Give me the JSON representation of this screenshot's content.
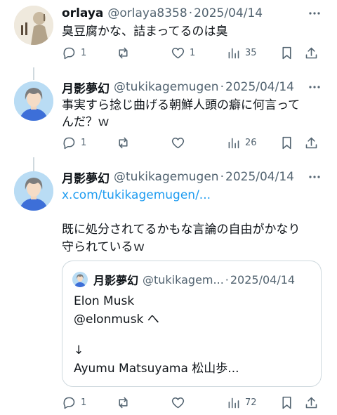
{
  "posts": [
    {
      "name": "orlaya",
      "handle": "@orlaya8358",
      "dot": "·",
      "date": "2025/04/14",
      "text": "臭豆腐かな、詰まってるのは臭",
      "replies": "1",
      "likes": "1",
      "views": "35"
    },
    {
      "name": "月影夢幻",
      "handle": "@tukikagemugen",
      "dot": "·",
      "date": "2025/04/14",
      "text_line1": "事実すら捻じ曲げる朝鮮人頭の癖に何言って",
      "text_line2": "んだ？ｗ",
      "replies": "1",
      "views": "26"
    },
    {
      "name": "月影夢幻",
      "handle": "@tukikagemugen",
      "dot": "·",
      "date": "2025/04/14",
      "link": "x.com/tukikagemugen/...",
      "text_line1": "既に処分されてるかもな言論の自由がかなり",
      "text_line2": "守られているｗ",
      "replies": "1",
      "views": "72",
      "quote": {
        "name": "月影夢幻",
        "handle": "@tukikagem...",
        "dot": "·",
        "date": "2025/04/14",
        "line1": "Elon Musk",
        "line2": "@elonmusk へ",
        "line3": "↓",
        "line4": "Ayumu Matsuyama 松山歩..."
      }
    }
  ],
  "colors": {
    "text": "#0f1419",
    "secondary": "#536471",
    "link": "#1d9bf0",
    "border": "#cfd9de"
  },
  "icons": [
    "more-icon",
    "reply-icon",
    "repost-icon",
    "like-icon",
    "views-icon",
    "bookmark-icon",
    "share-icon"
  ]
}
